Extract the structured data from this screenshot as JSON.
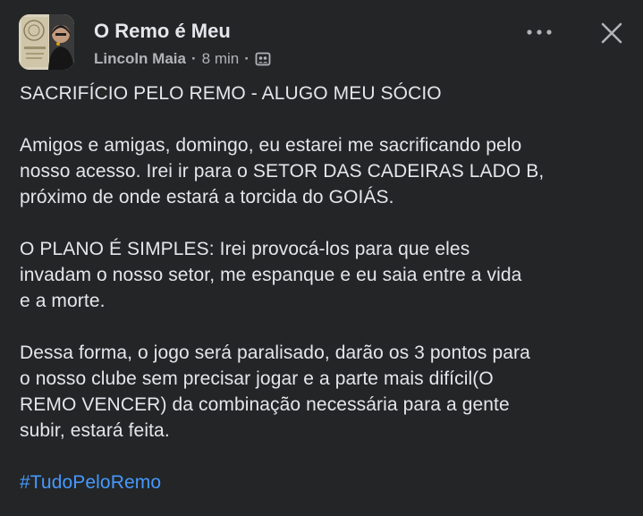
{
  "header": {
    "group_name": "O Remo é Meu",
    "author": "Lincoln Maia",
    "separator": "·",
    "time": "8 min",
    "separator2": "·",
    "audience_icon": "group-audience-icon",
    "more_icon": "more-options-icon",
    "close_icon": "close-icon"
  },
  "post": {
    "title": "SACRIFÍCIO PELO REMO - ALUGO MEU SÓCIO",
    "paragraph1": [
      "Amigos e amigas, domingo,  eu estarei me sacrificando pelo",
      "nosso acesso. Irei ir para o SETOR DAS CADEIRAS LADO B,",
      "próximo de onde estará a torcida do GOIÁS."
    ],
    "paragraph2": [
      "O PLANO É SIMPLES: Irei provocá-los para que eles",
      "invadam o nosso setor, me espanque e eu saia entre a vida",
      "e a morte."
    ],
    "paragraph3": [
      "Dessa forma, o jogo será paralisado, darão os 3 pontos para",
      "o nosso clube sem precisar jogar e a parte mais difícil(O",
      "REMO VENCER) da combinação necessária para a gente",
      "subir, estará feita."
    ],
    "hashtag": "#TudoPeloRemo"
  },
  "colors": {
    "background": "#242526",
    "primary_text": "#e4e6eb",
    "secondary_text": "#b0b3b8",
    "link": "#4599ff"
  }
}
